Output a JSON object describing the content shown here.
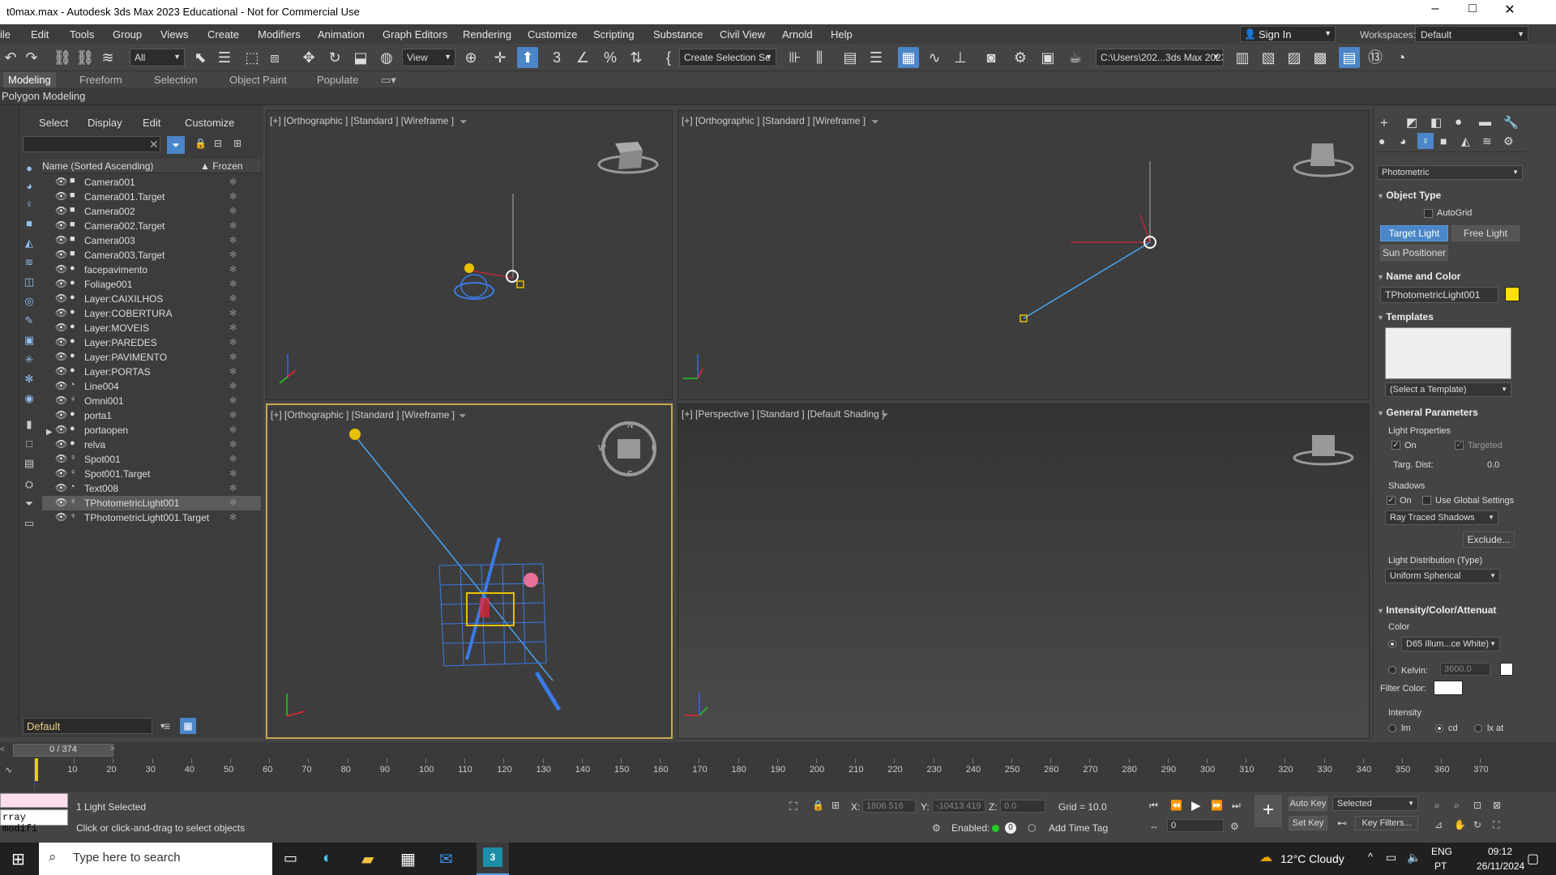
{
  "window": {
    "title": "t0max.max - Autodesk 3ds Max 2023 Educational - Not for Commercial Use"
  },
  "menu": [
    "ile",
    "Edit",
    "Tools",
    "Group",
    "Views",
    "Create",
    "Modifiers",
    "Animation",
    "Graph Editors",
    "Rendering",
    "Customize",
    "Scripting",
    "Substance",
    "Civil View",
    "Arnold",
    "Help"
  ],
  "signin": "Sign In",
  "workspaces": {
    "label": "Workspaces:",
    "value": "Default"
  },
  "toolbar": {
    "filter": "All",
    "ref_coord": "View",
    "selection_set": "Create Selection Se",
    "project_path": "C:\\Users\\202...3ds Max 2023"
  },
  "ribbon": {
    "tabs": [
      "Modeling",
      "Freeform",
      "Selection",
      "Object Paint",
      "Populate"
    ],
    "subtab": "Polygon Modeling"
  },
  "explorer": {
    "menu": [
      "Select",
      "Display",
      "Edit",
      "Customize"
    ],
    "col_name": "Name (Sorted Ascending)",
    "col_frozen": "▲ Frozen",
    "rows": [
      {
        "name": "Camera001",
        "icon": "■"
      },
      {
        "name": "Camera001.Target",
        "icon": "■"
      },
      {
        "name": "Camera002",
        "icon": "■"
      },
      {
        "name": "Camera002.Target",
        "icon": "■"
      },
      {
        "name": "Camera003",
        "icon": "■"
      },
      {
        "name": "Camera003.Target",
        "icon": "■"
      },
      {
        "name": "facepavimento",
        "icon": "●"
      },
      {
        "name": "Foliage001",
        "icon": "●"
      },
      {
        "name": "Layer:CAIXILHOS",
        "icon": "●"
      },
      {
        "name": "Layer:COBERTURA",
        "icon": "●"
      },
      {
        "name": "Layer:MOVEIS",
        "icon": "●"
      },
      {
        "name": "Layer:PAREDES",
        "icon": "●"
      },
      {
        "name": "Layer:PAVIMENTO",
        "icon": "●"
      },
      {
        "name": "Layer:PORTAS",
        "icon": "●"
      },
      {
        "name": "Line004",
        "icon": "◔"
      },
      {
        "name": "Omni001",
        "icon": "♀"
      },
      {
        "name": "porta1",
        "icon": "●"
      },
      {
        "name": "portaopen",
        "icon": "●"
      },
      {
        "name": "relva",
        "icon": "●"
      },
      {
        "name": "Spot001",
        "icon": "♀"
      },
      {
        "name": "Spot001.Target",
        "icon": "♀"
      },
      {
        "name": "Text008",
        "icon": "◔"
      },
      {
        "name": "TPhotometricLight001",
        "icon": "♀",
        "selected": true
      },
      {
        "name": "TPhotometricLight001.Target",
        "icon": "♀"
      }
    ],
    "layer": "Default"
  },
  "viewports": {
    "top_left": "[+] [Orthographic ] [Standard ] [Wireframe ]",
    "top_right": "[+] [Orthographic ] [Standard ] [Wireframe ]",
    "bottom_left": "[+] [Orthographic ] [Standard ] [Wireframe ]",
    "bottom_right": "[+] [Perspective ] [Standard ] [Default Shading ]",
    "compass": {
      "n": "N",
      "s": "S",
      "e": "E",
      "w": "W"
    }
  },
  "cmd": {
    "category": "Photometric",
    "object_type": "Object Type",
    "autogrid": "AutoGrid",
    "target_light": "Target Light",
    "free_light": "Free Light",
    "sun_positioner": "Sun Positioner",
    "name_color": "Name and Color",
    "object_name": "TPhotometricLight001",
    "object_color": "#ffe000",
    "templates": "Templates",
    "template_select": "(Select a Template)",
    "general": "General Parameters",
    "light_props": "Light Properties",
    "on": "On",
    "targeted": "Targeted",
    "targ_dist_label": "Targ. Dist:",
    "targ_dist": "0.0",
    "shadows": "Shadows",
    "shadows_on": "On",
    "use_global": "Use Global Settings",
    "shadow_type": "Ray Traced Shadows",
    "exclude": "Exclude...",
    "distribution_label": "Light Distribution (Type)",
    "distribution": "Uniform Spherical",
    "intensity_section": "Intensity/Color/Attenuat",
    "color_label": "Color",
    "color_preset": "D65 Illum...ce White)",
    "kelvin_label": "Kelvin:",
    "kelvin": "3600.0",
    "filter_label": "Filter Color:",
    "intensity_label": "Intensity",
    "units": [
      "lm",
      "cd",
      "lx at"
    ]
  },
  "timeline": {
    "frame": "0 / 374",
    "ticks": [
      10,
      20,
      30,
      40,
      50,
      60,
      70,
      80,
      90,
      100,
      110,
      120,
      130,
      140,
      150,
      160,
      170,
      180,
      190,
      200,
      210,
      220,
      230,
      240,
      250,
      260,
      270,
      280,
      290,
      300,
      310,
      320,
      330,
      340,
      350,
      360,
      370
    ]
  },
  "status": {
    "script_box": "rray modifi",
    "selected": "1 Light Selected",
    "hint": "Click or click-and-drag to select objects",
    "x_label": "X:",
    "x": "1806.516",
    "y_label": "Y:",
    "y": "-10413.419",
    "z_label": "Z:",
    "z": "0.0",
    "grid": "Grid = 10.0",
    "enabled": "Enabled:",
    "add_time_tag": "Add Time Tag",
    "auto_key": "Auto Key",
    "set_key": "Set Key",
    "key_mode": "Selected",
    "key_filters": "Key Filters...",
    "current_frame": "0"
  },
  "taskbar": {
    "search": "Type here to search",
    "weather": "12°C  Cloudy",
    "lang1": "ENG",
    "lang2": "PT",
    "time": "09:12",
    "date": "26/11/2024"
  }
}
